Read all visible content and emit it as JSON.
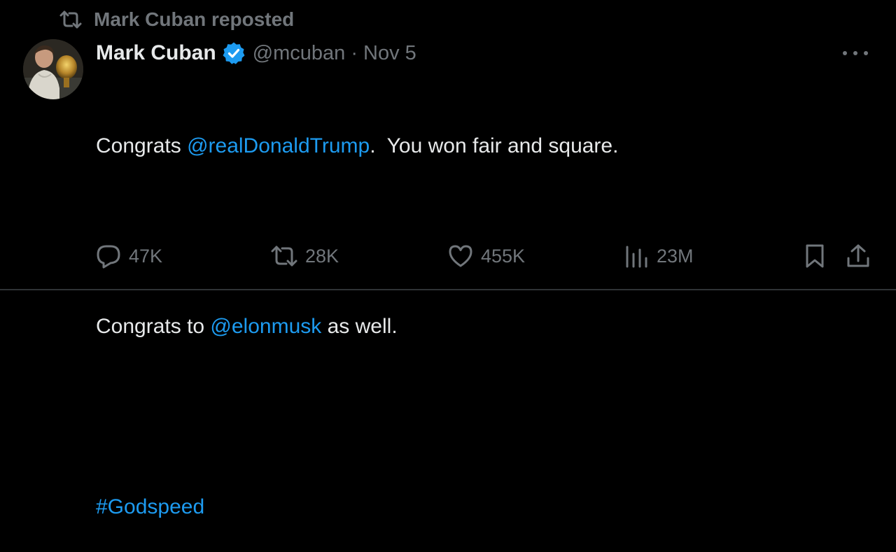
{
  "repost": {
    "icon": "repost-icon",
    "label": "Mark Cuban reposted"
  },
  "post": {
    "author_name": "Mark Cuban",
    "verified_icon": "verified-badge-icon",
    "handle": "@mcuban",
    "separator": "·",
    "date": "Nov 5",
    "more_icon": "more-options-icon",
    "text": {
      "line1_prefix": "Congrats ",
      "mention1": "@realDonaldTrump",
      "line1_suffix": ".  You won fair and square.",
      "line2_prefix": "Congrats to ",
      "mention2": "@elonmusk",
      "line2_suffix": " as well.",
      "hashtag": "#Godspeed"
    }
  },
  "actions": {
    "replies": {
      "icon": "reply-icon",
      "count": "47K"
    },
    "reposts": {
      "icon": "repost-icon",
      "count": "28K"
    },
    "likes": {
      "icon": "like-icon",
      "count": "455K"
    },
    "views": {
      "icon": "views-icon",
      "count": "23M"
    },
    "bookmark": {
      "icon": "bookmark-icon"
    },
    "share": {
      "icon": "share-icon"
    }
  },
  "colors": {
    "background": "#000000",
    "text_primary": "#e7e9ea",
    "text_secondary": "#71767b",
    "accent": "#1d9bf0",
    "divider": "#2f3336"
  }
}
